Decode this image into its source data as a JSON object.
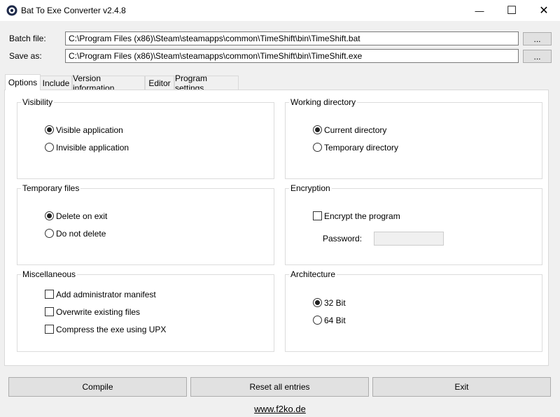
{
  "window": {
    "title": "Bat To Exe Converter v2.4.8",
    "minimize_glyph": "—",
    "maximize_glyph": "☐",
    "close_glyph": "✕"
  },
  "files": {
    "batch_label": "Batch file:",
    "batch_value": "C:\\Program Files (x86)\\Steam\\steamapps\\common\\TimeShift\\bin\\TimeShift.bat",
    "save_label": "Save as:",
    "save_value": "C:\\Program Files (x86)\\Steam\\steamapps\\common\\TimeShift\\bin\\TimeShift.exe",
    "browse_label": "..."
  },
  "tabs": [
    {
      "label": "Options",
      "active": true
    },
    {
      "label": "Include",
      "active": false
    },
    {
      "label": "Version information",
      "active": false
    },
    {
      "label": "Editor",
      "active": false
    },
    {
      "label": "Program settings",
      "active": false
    }
  ],
  "groups": {
    "visibility": {
      "title": "Visibility",
      "options": [
        {
          "label": "Visible application",
          "checked": true
        },
        {
          "label": "Invisible application",
          "checked": false
        }
      ]
    },
    "working_directory": {
      "title": "Working directory",
      "options": [
        {
          "label": "Current directory",
          "checked": true
        },
        {
          "label": "Temporary directory",
          "checked": false
        }
      ]
    },
    "temporary_files": {
      "title": "Temporary files",
      "options": [
        {
          "label": "Delete on exit",
          "checked": true
        },
        {
          "label": "Do not delete",
          "checked": false
        }
      ]
    },
    "encryption": {
      "title": "Encryption",
      "encrypt_label": "Encrypt the program",
      "encrypt_checked": false,
      "password_label": "Password:",
      "password_value": ""
    },
    "miscellaneous": {
      "title": "Miscellaneous",
      "options": [
        {
          "label": "Add administrator manifest",
          "checked": false
        },
        {
          "label": "Overwrite existing files",
          "checked": false
        },
        {
          "label": "Compress the exe using UPX",
          "checked": false
        }
      ]
    },
    "architecture": {
      "title": "Architecture",
      "options": [
        {
          "label": "32 Bit",
          "checked": true
        },
        {
          "label": "64 Bit",
          "checked": false
        }
      ]
    }
  },
  "buttons": {
    "compile": "Compile",
    "reset": "Reset all entries",
    "exit": "Exit"
  },
  "footer": {
    "link": "www.f2ko.de"
  }
}
